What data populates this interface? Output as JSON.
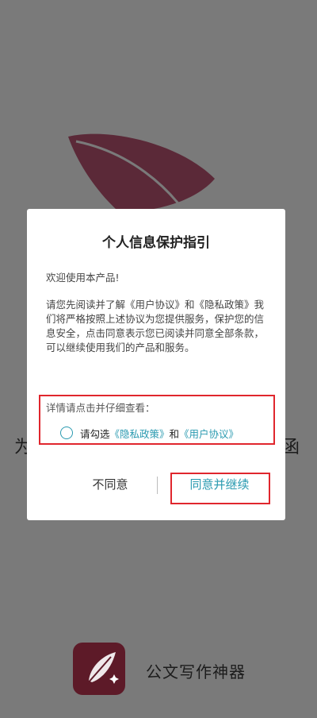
{
  "background": {
    "left_char": "为",
    "right_char": "函"
  },
  "dialog": {
    "title": "个人信息保护指引",
    "welcome": "欢迎使用本产品!",
    "body_part1": "请您先阅读并了解《用户协议》和《隐私政策》我们将严格按照上述协议为您提供服务，保护您的信息安全，点击同意表示您已阅读并同意全部条款，可以继续使用我们的产品和服务。",
    "detail_hint": "详情请点击并仔细查看：",
    "consent_prefix": "请勾选",
    "privacy_link": "《隐私政策》",
    "consent_and": "和",
    "user_agreement_link": "《用户协议》",
    "disagree_label": "不同意",
    "agree_label": "同意并继续"
  },
  "app": {
    "name": "公文写作神器"
  },
  "colors": {
    "accent": "#2a9ab0",
    "highlight_red": "#e0262d",
    "brand_maroon": "#5d1a28",
    "overlay_gray": "#7a7a7a"
  },
  "icons": {
    "feather": "feather-icon",
    "app": "app-logo-icon",
    "radio": "radio-unchecked-icon"
  }
}
